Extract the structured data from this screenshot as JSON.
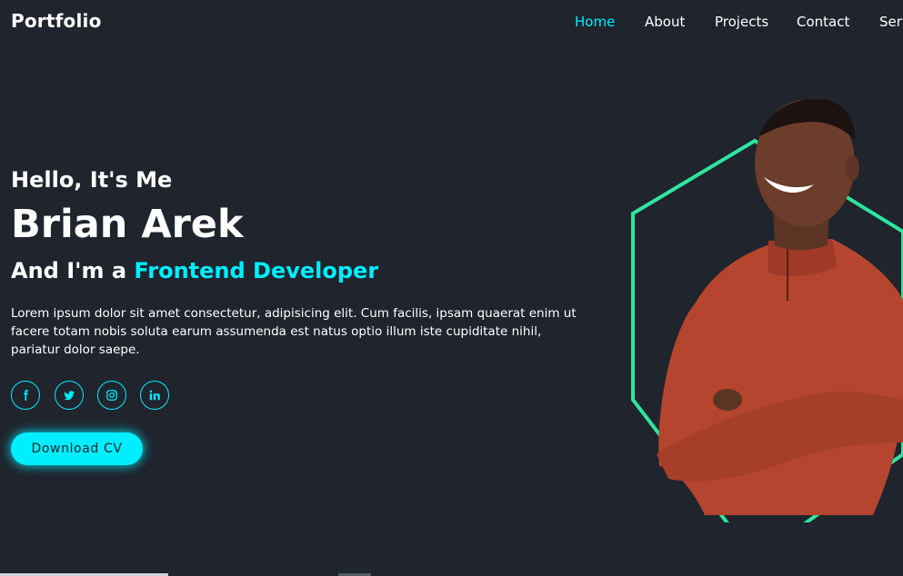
{
  "header": {
    "logo": "Portfolio",
    "nav": [
      {
        "label": "Home",
        "active": true
      },
      {
        "label": "About",
        "active": false
      },
      {
        "label": "Projects",
        "active": false
      },
      {
        "label": "Contact",
        "active": false
      },
      {
        "label": "Serv",
        "active": false
      }
    ]
  },
  "hero": {
    "greeting": "Hello, It's Me",
    "name": "Brian Arek",
    "role_prefix": "And I'm a ",
    "role_highlight": "Frontend Developer",
    "description": "Lorem ipsum dolor sit amet consectetur, adipisicing elit. Cum facilis, ipsam quaerat enim ut facere totam nobis soluta earum assumenda est natus optio illum iste cupiditate nihil, pariatur dolor saepe.",
    "socials": [
      {
        "icon": "facebook-icon"
      },
      {
        "icon": "twitter-icon"
      },
      {
        "icon": "instagram-icon"
      },
      {
        "icon": "linkedin-icon"
      }
    ],
    "cta_label": "Download CV"
  },
  "colors": {
    "background": "#1f242d",
    "accent": "#00eeff",
    "hexagon": "#2ee59d",
    "sweater": "#b5452f"
  }
}
